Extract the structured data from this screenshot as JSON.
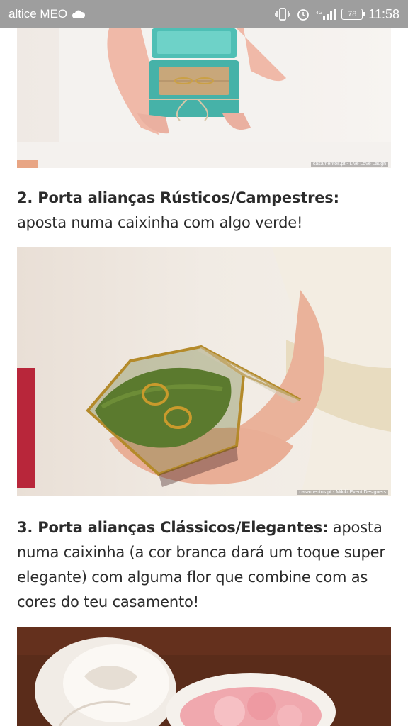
{
  "status_bar": {
    "carrier": "altice MEO",
    "battery": "78",
    "time": "11:58",
    "icons": [
      "cloud-icon",
      "vibrate-icon",
      "alarm-icon",
      "signal-icon",
      "battery-icon"
    ]
  },
  "article": {
    "image1_credit": "casamentos.pt - Live Love Laugh",
    "section2_heading": "2. Porta alianças Rústicos/Campestres:",
    "section2_text": " aposta numa caixinha com algo verde!",
    "image2_credit": "casamentos.pt - Mikiki Event Designers",
    "section3_heading": "3. Porta alianças Clássicos/Elegantes:",
    "section3_text": " aposta numa caixinha (a cor branca dará um toque super elegante) com alguma flor que combine com as cores do teu casamento!"
  },
  "colors": {
    "status_bar_bg": "#9e9e9e",
    "text": "#2b2b2b",
    "teal_box": "#4fbfb5",
    "moss_green": "#5b7a2e",
    "brass": "#b48a2a",
    "wood": "#5a2c1a"
  }
}
